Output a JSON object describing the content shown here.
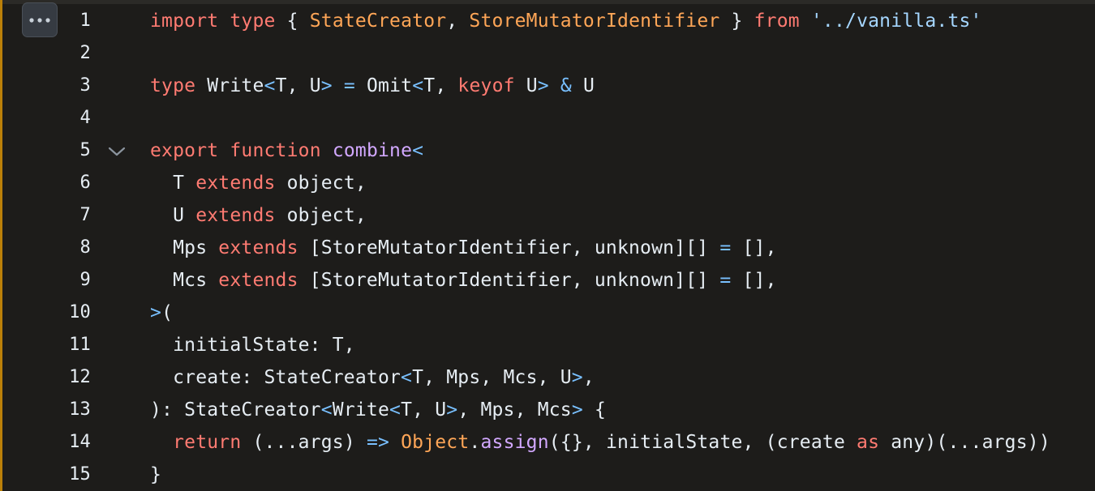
{
  "toolbar": {
    "more_icon": "kebab-horizontal-icon",
    "fold_icon": "chevron-down-icon"
  },
  "colors": {
    "background": "#1d1c1a",
    "keyword": "#ff7b72",
    "type_name": "#ffa657",
    "string": "#a5d6ff",
    "operator": "#79c0ff",
    "function": "#d2a8ff",
    "plain": "#e6edf3",
    "accent": "#bb8009"
  },
  "code": {
    "lines": [
      {
        "number": "1",
        "tokens": [
          {
            "t": "import",
            "k": "keyword"
          },
          {
            "t": " "
          },
          {
            "t": "type",
            "k": "keyword"
          },
          {
            "t": " { "
          },
          {
            "t": "StateCreator",
            "k": "type-name"
          },
          {
            "t": ", "
          },
          {
            "t": "StoreMutatorIdentifier",
            "k": "type-name"
          },
          {
            "t": " } "
          },
          {
            "t": "from",
            "k": "keyword"
          },
          {
            "t": " "
          },
          {
            "t": "'../vanilla.ts'",
            "k": "string"
          }
        ]
      },
      {
        "number": "2",
        "tokens": []
      },
      {
        "number": "3",
        "tokens": [
          {
            "t": "type",
            "k": "keyword"
          },
          {
            "t": " Write"
          },
          {
            "t": "<",
            "k": "operator"
          },
          {
            "t": "T, U"
          },
          {
            "t": ">",
            "k": "operator"
          },
          {
            "t": " "
          },
          {
            "t": "=",
            "k": "operator"
          },
          {
            "t": " Omit"
          },
          {
            "t": "<",
            "k": "operator"
          },
          {
            "t": "T, "
          },
          {
            "t": "keyof",
            "k": "keyword"
          },
          {
            "t": " U"
          },
          {
            "t": ">",
            "k": "operator"
          },
          {
            "t": " "
          },
          {
            "t": "&",
            "k": "operator"
          },
          {
            "t": " U"
          }
        ]
      },
      {
        "number": "4",
        "tokens": []
      },
      {
        "number": "5",
        "fold": true,
        "tokens": [
          {
            "t": "export",
            "k": "keyword"
          },
          {
            "t": " "
          },
          {
            "t": "function",
            "k": "keyword"
          },
          {
            "t": " "
          },
          {
            "t": "combine",
            "k": "function"
          },
          {
            "t": "<",
            "k": "operator"
          }
        ]
      },
      {
        "number": "6",
        "tokens": [
          {
            "t": "  T "
          },
          {
            "t": "extends",
            "k": "keyword"
          },
          {
            "t": " object,"
          }
        ]
      },
      {
        "number": "7",
        "tokens": [
          {
            "t": "  U "
          },
          {
            "t": "extends",
            "k": "keyword"
          },
          {
            "t": " object,"
          }
        ]
      },
      {
        "number": "8",
        "tokens": [
          {
            "t": "  Mps "
          },
          {
            "t": "extends",
            "k": "keyword"
          },
          {
            "t": " [StoreMutatorIdentifier, unknown][] "
          },
          {
            "t": "=",
            "k": "operator"
          },
          {
            "t": " [],"
          }
        ]
      },
      {
        "number": "9",
        "tokens": [
          {
            "t": "  Mcs "
          },
          {
            "t": "extends",
            "k": "keyword"
          },
          {
            "t": " [StoreMutatorIdentifier, unknown][] "
          },
          {
            "t": "=",
            "k": "operator"
          },
          {
            "t": " [],"
          }
        ]
      },
      {
        "number": "10",
        "tokens": [
          {
            "t": ">",
            "k": "operator"
          },
          {
            "t": "("
          }
        ]
      },
      {
        "number": "11",
        "tokens": [
          {
            "t": "  initialState: T,"
          }
        ]
      },
      {
        "number": "12",
        "tokens": [
          {
            "t": "  create: StateCreator"
          },
          {
            "t": "<",
            "k": "operator"
          },
          {
            "t": "T, Mps, Mcs, U"
          },
          {
            "t": ">",
            "k": "operator"
          },
          {
            "t": ","
          }
        ]
      },
      {
        "number": "13",
        "tokens": [
          {
            "t": "): StateCreator"
          },
          {
            "t": "<",
            "k": "operator"
          },
          {
            "t": "Write"
          },
          {
            "t": "<",
            "k": "operator"
          },
          {
            "t": "T, U"
          },
          {
            "t": ">",
            "k": "operator"
          },
          {
            "t": ", Mps, Mcs"
          },
          {
            "t": ">",
            "k": "operator"
          },
          {
            "t": " {"
          }
        ]
      },
      {
        "number": "14",
        "tokens": [
          {
            "t": "  "
          },
          {
            "t": "return",
            "k": "keyword"
          },
          {
            "t": " (...args) "
          },
          {
            "t": "=>",
            "k": "operator"
          },
          {
            "t": " "
          },
          {
            "t": "Object",
            "k": "type-name"
          },
          {
            "t": "."
          },
          {
            "t": "assign",
            "k": "function"
          },
          {
            "t": "({}, initialState, (create "
          },
          {
            "t": "as",
            "k": "keyword"
          },
          {
            "t": " any)(...args))"
          }
        ]
      },
      {
        "number": "15",
        "tokens": [
          {
            "t": "}"
          }
        ]
      }
    ]
  }
}
